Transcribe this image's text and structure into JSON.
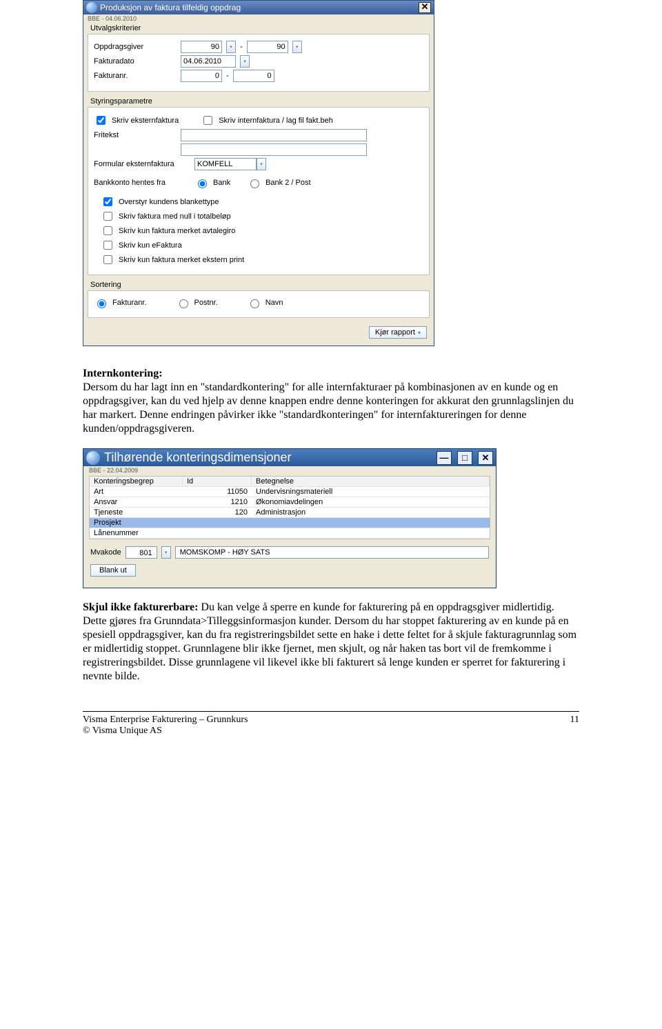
{
  "dialog1": {
    "title": "Produksjon av faktura tilfeldig oppdrag",
    "subheader": "BBE - 04.06.2010",
    "group_utvalg": "Utvalgskriterier",
    "oppdragsgiver_label": "Oppdragsgiver",
    "oppdragsgiver_from": "90",
    "oppdragsgiver_to": "90",
    "fakturadato_label": "Fakturadato",
    "fakturadato_value": "04.06.2010",
    "fakturanr_label": "Fakturanr.",
    "fakturanr_from": "0",
    "fakturanr_to": "0",
    "group_styring": "Styringsparametre",
    "cb_ekstern": "Skriv eksternfaktura",
    "cb_intern": "Skriv internfaktura / lag fil fakt.beh",
    "fritekst_label": "Fritekst",
    "formular_label": "Formular eksternfaktura",
    "formular_value": "KOMFELL",
    "bankkonto_label": "Bankkonto hentes fra",
    "radio_bank": "Bank",
    "radio_bank2": "Bank 2 / Post",
    "cb_overstyr": "Overstyr kundens blankettype",
    "cb_null": "Skriv faktura med null i totalbeløp",
    "cb_avtale": "Skriv kun faktura merket avtalegiro",
    "cb_efaktura": "Skriv kun eFaktura",
    "cb_eksternprint": "Skriv kun faktura merket ekstern print",
    "group_sort": "Sortering",
    "sort_fakturanr": "Fakturanr.",
    "sort_postnr": "Postnr.",
    "sort_navn": "Navn",
    "run_button": "Kjør rapport"
  },
  "para1_head": "Internkontering:",
  "para1": "Dersom du har lagt inn en \"standardkontering\" for alle internfakturaer på kombinasjonen av en kunde og en oppdragsgiver, kan du ved hjelp av denne knappen endre denne konteringen for akkurat den grunnlagslinjen du har markert.  Denne endringen påvirker ikke \"standardkonteringen\" for internfaktureringen for denne kunden/oppdragsgiveren.",
  "dialog2": {
    "title": "Tilhørende konteringsdimensjoner",
    "subheader": "BBE - 22.04.2009",
    "col1": "Konteringsbegrep",
    "col2": "Id",
    "col3": "Betegnelse",
    "rows": [
      {
        "k": "Art",
        "id": "11050",
        "b": "Undervisningsmateriell"
      },
      {
        "k": "Ansvar",
        "id": "1210",
        "b": "Økonomiavdelingen"
      },
      {
        "k": "Tjeneste",
        "id": "120",
        "b": "Administrasjon"
      },
      {
        "k": "Prosjekt",
        "id": "",
        "b": ""
      },
      {
        "k": "Lånenummer",
        "id": "",
        "b": ""
      }
    ],
    "mvakode_label": "Mvakode",
    "mvakode_value": "801",
    "mvakode_text": "MOMSKOMP - HØY SATS",
    "blank_btn": "Blank ut"
  },
  "para2_head": "Skjul ikke fakturerbare:",
  "para2": " Du kan velge å sperre en kunde for fakturering på en oppdragsgiver midlertidig. Dette gjøres fra Grunndata>Tilleggsinformasjon kunder. Dersom du har stoppet fakturering av en kunde på en spesiell oppdragsgiver, kan du fra registreringsbildet sette en hake i dette feltet for å skjule fakturagrunnlag som er midlertidig stoppet.  Grunnlagene blir ikke fjernet, men skjult, og når haken tas bort vil de fremkomme i registreringsbildet. Disse grunnlagene vil likevel ikke bli fakturert så lenge kunden er sperret for fakturering i nevnte bilde.",
  "footer": {
    "line1": "Visma Enterprise Fakturering – Grunnkurs",
    "line2": "© Visma Unique AS",
    "page": "11"
  }
}
